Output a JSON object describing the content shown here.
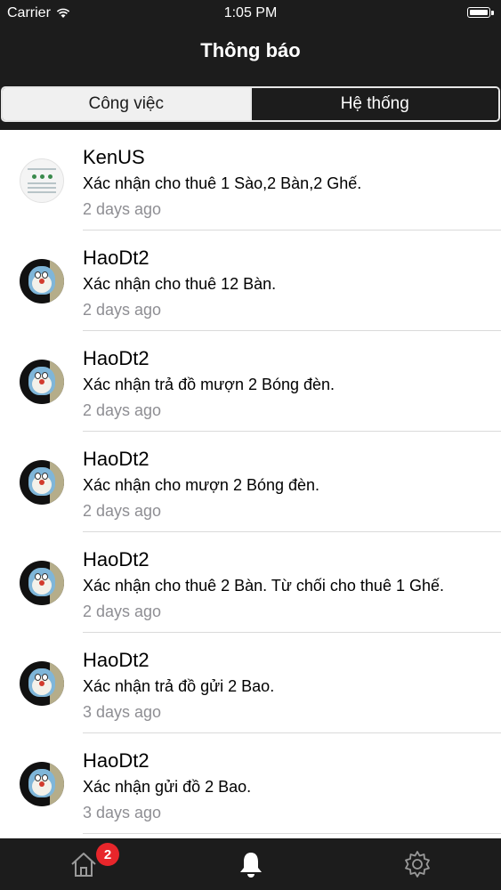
{
  "status_bar": {
    "carrier": "Carrier",
    "time": "1:05 PM"
  },
  "header": {
    "title": "Thông báo"
  },
  "segments": [
    {
      "label": "Công việc",
      "selected": true
    },
    {
      "label": "Hệ thống",
      "selected": false
    }
  ],
  "notifications": [
    {
      "name": "KenUS",
      "message": "Xác nhận cho thuê 1 Sào,2 Bàn,2 Ghế.",
      "time": "2 days ago",
      "avatar": "document-thumbnail"
    },
    {
      "name": "HaoDt2",
      "message": "Xác nhận cho thuê 12 Bàn.",
      "time": "2 days ago",
      "avatar": "cartoon-character"
    },
    {
      "name": "HaoDt2",
      "message": "Xác nhận trả đồ mượn 2 Bóng đèn.",
      "time": "2 days ago",
      "avatar": "cartoon-character"
    },
    {
      "name": "HaoDt2",
      "message": "Xác nhận cho mượn 2 Bóng đèn.",
      "time": "2 days ago",
      "avatar": "cartoon-character"
    },
    {
      "name": "HaoDt2",
      "message": "Xác nhận cho thuê 2 Bàn. Từ chối cho thuê 1 Ghế.",
      "time": "2 days ago",
      "avatar": "cartoon-character"
    },
    {
      "name": "HaoDt2",
      "message": "Xác nhận trả đồ gửi 2 Bao.",
      "time": "3 days ago",
      "avatar": "cartoon-character"
    },
    {
      "name": "HaoDt2",
      "message": "Xác nhận gửi đồ 2 Bao.",
      "time": "3 days ago",
      "avatar": "cartoon-character"
    }
  ],
  "tab_bar": {
    "tabs": [
      {
        "icon": "home-icon",
        "badge": "2",
        "selected": false
      },
      {
        "icon": "bell-icon",
        "selected": true
      },
      {
        "icon": "gear-icon",
        "selected": false
      }
    ]
  },
  "colors": {
    "bar_background": "#1c1c1c",
    "badge": "#e8262b",
    "secondary_text": "#8e8e93",
    "divider": "#dadada"
  }
}
